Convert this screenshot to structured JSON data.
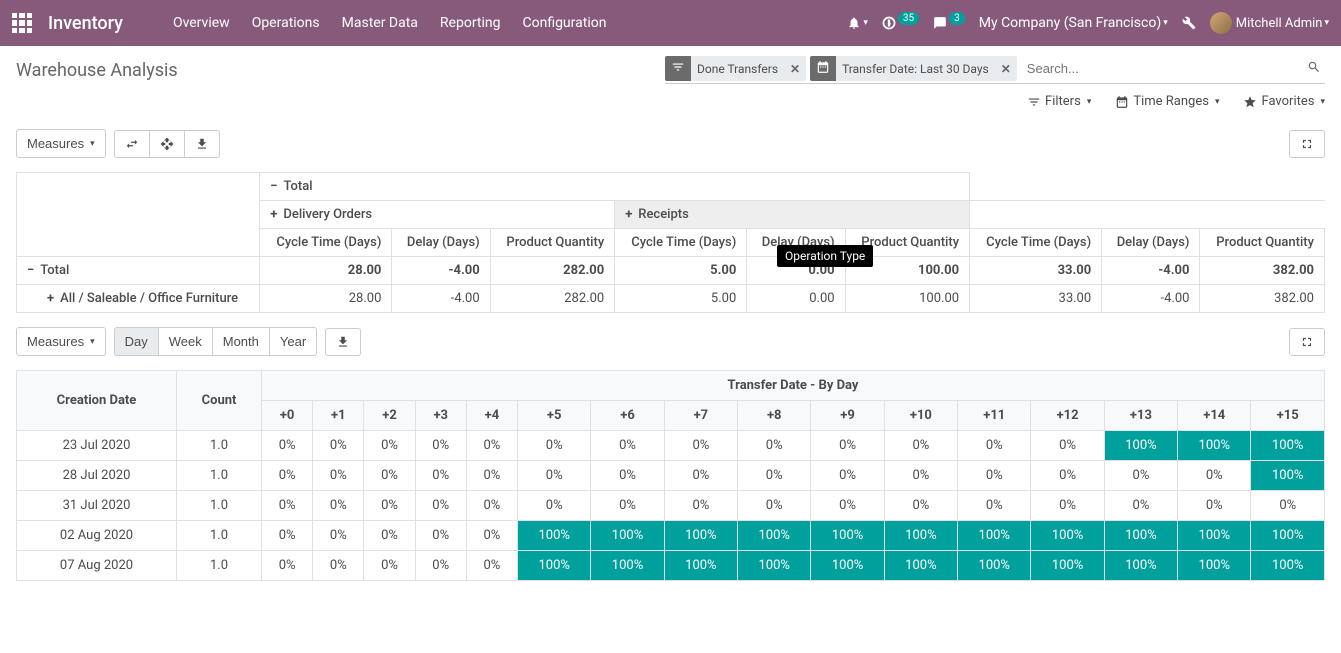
{
  "topbar": {
    "brand": "Inventory",
    "menu": [
      "Overview",
      "Operations",
      "Master Data",
      "Reporting",
      "Configuration"
    ],
    "activities_badge": "35",
    "discuss_badge": "3",
    "company": "My Company (San Francisco)",
    "user": "Mitchell Admin"
  },
  "page": {
    "title": "Warehouse Analysis",
    "facets": [
      {
        "icon": "filter",
        "label": "Done Transfers"
      },
      {
        "icon": "calendar",
        "label": "Transfer Date: Last 30 Days"
      }
    ],
    "search_placeholder": "Search...",
    "toolbar": {
      "filters": "Filters",
      "time_ranges": "Time Ranges",
      "favorites": "Favorites"
    }
  },
  "pivot": {
    "measures_label": "Measures",
    "total_label": "Total",
    "groups": [
      "Delivery Orders",
      "Receipts"
    ],
    "measure_headers": [
      "Cycle Time (Days)",
      "Delay (Days)",
      "Product Quantity"
    ],
    "tooltip": "Operation Type",
    "rows": [
      {
        "label": "Total",
        "expand": "−",
        "bold": true,
        "values": [
          "28.00",
          "-4.00",
          "282.00",
          "5.00",
          "0.00",
          "100.00",
          "33.00",
          "-4.00",
          "382.00"
        ]
      },
      {
        "label": "All / Saleable / Office Furniture",
        "expand": "+",
        "indent": true,
        "values": [
          "28.00",
          "-4.00",
          "282.00",
          "5.00",
          "0.00",
          "100.00",
          "33.00",
          "-4.00",
          "382.00"
        ]
      }
    ]
  },
  "cohort": {
    "measures_label": "Measures",
    "intervals": [
      "Day",
      "Week",
      "Month",
      "Year"
    ],
    "active_interval": "Day",
    "row_label": "Creation Date",
    "count_label": "Count",
    "group_label": "Transfer Date - By Day",
    "cols": [
      "+0",
      "+1",
      "+2",
      "+3",
      "+4",
      "+5",
      "+6",
      "+7",
      "+8",
      "+9",
      "+10",
      "+11",
      "+12",
      "+13",
      "+14",
      "+15"
    ],
    "rows": [
      {
        "date": "23 Jul 2020",
        "count": "1.0",
        "cells": [
          "0%",
          "0%",
          "0%",
          "0%",
          "0%",
          "0%",
          "0%",
          "0%",
          "0%",
          "0%",
          "0%",
          "0%",
          "0%",
          "100%",
          "100%",
          "100%"
        ]
      },
      {
        "date": "28 Jul 2020",
        "count": "1.0",
        "cells": [
          "0%",
          "0%",
          "0%",
          "0%",
          "0%",
          "0%",
          "0%",
          "0%",
          "0%",
          "0%",
          "0%",
          "0%",
          "0%",
          "0%",
          "0%",
          "100%"
        ]
      },
      {
        "date": "31 Jul 2020",
        "count": "1.0",
        "cells": [
          "0%",
          "0%",
          "0%",
          "0%",
          "0%",
          "0%",
          "0%",
          "0%",
          "0%",
          "0%",
          "0%",
          "0%",
          "0%",
          "0%",
          "0%",
          "0%"
        ]
      },
      {
        "date": "02 Aug 2020",
        "count": "1.0",
        "cells": [
          "0%",
          "0%",
          "0%",
          "0%",
          "0%",
          "100%",
          "100%",
          "100%",
          "100%",
          "100%",
          "100%",
          "100%",
          "100%",
          "100%",
          "100%",
          "100%"
        ]
      },
      {
        "date": "07 Aug 2020",
        "count": "1.0",
        "cells": [
          "0%",
          "0%",
          "0%",
          "0%",
          "0%",
          "100%",
          "100%",
          "100%",
          "100%",
          "100%",
          "100%",
          "100%",
          "100%",
          "100%",
          "100%",
          "100%"
        ]
      }
    ]
  }
}
